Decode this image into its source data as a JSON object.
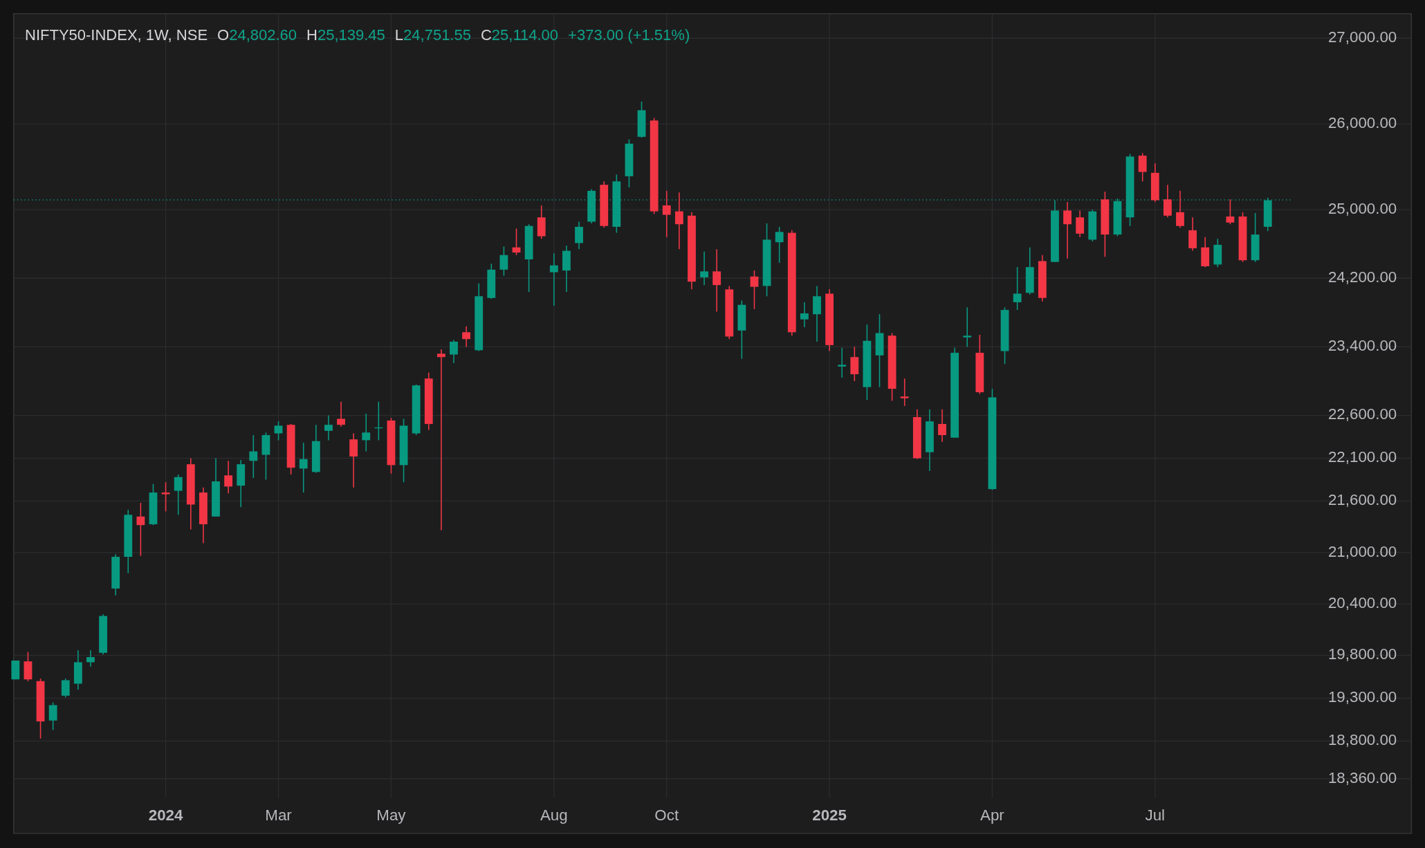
{
  "legend": {
    "symbol": "NIFTY50-INDEX, 1W, NSE",
    "values": [
      {
        "label": "O",
        "value": "24,802.60"
      },
      {
        "label": "H",
        "value": "25,139.45"
      },
      {
        "label": "L",
        "value": "24,751.55"
      },
      {
        "label": "C",
        "value": "25,114.00"
      }
    ],
    "change": "+373.00 (+1.51%)"
  },
  "chart": {
    "emphasized_labels": [
      true,
      false,
      false,
      false,
      false,
      true,
      false,
      false
    ],
    "chart_data": {
      "type": "candlestick",
      "ylim": [
        18137,
        27286
      ],
      "grid": true,
      "ref_lines": [
        {
          "axis": "y",
          "value": 25114,
          "color": "#089981"
        }
      ],
      "categories": [
        null,
        null,
        null,
        null,
        null,
        null,
        null,
        null,
        null,
        null,
        null,
        null,
        "2024",
        null,
        null,
        null,
        null,
        null,
        null,
        null,
        null,
        "Mar",
        null,
        null,
        null,
        null,
        null,
        null,
        null,
        null,
        "May",
        null,
        null,
        null,
        null,
        null,
        null,
        null,
        null,
        null,
        null,
        null,
        null,
        "Aug",
        null,
        null,
        null,
        null,
        null,
        null,
        null,
        null,
        "Oct",
        null,
        null,
        null,
        null,
        null,
        null,
        null,
        null,
        null,
        null,
        null,
        null,
        "2025",
        null,
        null,
        null,
        null,
        null,
        null,
        null,
        null,
        null,
        null,
        null,
        null,
        "Apr",
        null,
        null,
        null,
        null,
        null,
        null,
        null,
        null,
        null,
        null,
        null,
        null,
        "Jul",
        null,
        null,
        null,
        null,
        null,
        null,
        null,
        null,
        null
      ],
      "yticks": [
        {
          "value": 27000,
          "label": "27,000.00"
        },
        {
          "value": 26000,
          "label": "26,000.00"
        },
        {
          "value": 25000,
          "label": "25,000.00"
        },
        {
          "value": 24200,
          "label": "24,200.00"
        },
        {
          "value": 23400,
          "label": "23,400.00"
        },
        {
          "value": 22600,
          "label": "22,600.00"
        },
        {
          "value": 22100,
          "label": "22,100.00"
        },
        {
          "value": 21600,
          "label": "21,600.00"
        },
        {
          "value": 21000,
          "label": "21,000.00"
        },
        {
          "value": 20400,
          "label": "20,400.00"
        },
        {
          "value": 19800,
          "label": "19,800.00"
        },
        {
          "value": 19300,
          "label": "19,300.00"
        },
        {
          "value": 18800,
          "label": "18,800.00"
        },
        {
          "value": 18360,
          "label": "18,360.00"
        }
      ],
      "ohlc": [
        [
          19520,
          19740,
          19520,
          19740
        ],
        [
          19730,
          19840,
          19500,
          19520
        ],
        [
          19500,
          19530,
          18830,
          19030
        ],
        [
          19040,
          19250,
          18930,
          19220
        ],
        [
          19330,
          19530,
          19310,
          19510
        ],
        [
          19470,
          19860,
          19400,
          19720
        ],
        [
          19720,
          19860,
          19670,
          19780
        ],
        [
          19830,
          20280,
          19810,
          20260
        ],
        [
          20580,
          20980,
          20500,
          20950
        ],
        [
          20950,
          21500,
          20760,
          21440
        ],
        [
          21420,
          21580,
          20960,
          21320
        ],
        [
          21330,
          21800,
          21320,
          21700
        ],
        [
          21700,
          21820,
          21480,
          21680
        ],
        [
          21720,
          21910,
          21440,
          21880
        ],
        [
          22030,
          22100,
          21270,
          21560
        ],
        [
          21700,
          21760,
          21110,
          21330
        ],
        [
          21420,
          22100,
          21420,
          21830
        ],
        [
          21900,
          22070,
          21690,
          21770
        ],
        [
          21780,
          22080,
          21530,
          22030
        ],
        [
          22070,
          22370,
          21870,
          22180
        ],
        [
          22140,
          22400,
          21850,
          22370
        ],
        [
          22390,
          22530,
          22310,
          22480
        ],
        [
          22490,
          22500,
          21910,
          21990
        ],
        [
          21980,
          22280,
          21700,
          22090
        ],
        [
          21940,
          22490,
          21930,
          22300
        ],
        [
          22420,
          22600,
          22310,
          22490
        ],
        [
          22560,
          22760,
          22470,
          22490
        ],
        [
          22320,
          22390,
          21760,
          22120
        ],
        [
          22310,
          22620,
          22180,
          22400
        ],
        [
          22450,
          22760,
          22310,
          22460
        ],
        [
          22540,
          22570,
          21920,
          22020
        ],
        [
          22020,
          22560,
          21820,
          22480
        ],
        [
          22390,
          22960,
          22370,
          22950
        ],
        [
          23030,
          23100,
          22430,
          22500
        ],
        [
          23320,
          23370,
          21260,
          23280
        ],
        [
          23310,
          23480,
          23210,
          23460
        ],
        [
          23570,
          23640,
          23400,
          23490
        ],
        [
          23360,
          24140,
          23350,
          23990
        ],
        [
          23970,
          24370,
          23960,
          24300
        ],
        [
          24300,
          24570,
          24230,
          24470
        ],
        [
          24560,
          24780,
          24470,
          24500
        ],
        [
          24420,
          24830,
          24040,
          24810
        ],
        [
          24910,
          25050,
          24660,
          24690
        ],
        [
          24270,
          24490,
          23880,
          24350
        ],
        [
          24290,
          24580,
          24040,
          24520
        ],
        [
          24610,
          24860,
          24540,
          24800
        ],
        [
          24860,
          25240,
          24840,
          25220
        ],
        [
          25290,
          25330,
          24790,
          24810
        ],
        [
          24800,
          25410,
          24730,
          25330
        ],
        [
          25390,
          25820,
          25260,
          25770
        ],
        [
          25850,
          26260,
          25840,
          26160
        ],
        [
          26040,
          26070,
          24950,
          24980
        ],
        [
          25050,
          25220,
          24680,
          24940
        ],
        [
          24980,
          25200,
          24540,
          24830
        ],
        [
          24930,
          24970,
          24070,
          24160
        ],
        [
          24210,
          24510,
          24120,
          24280
        ],
        [
          24280,
          24540,
          23810,
          24120
        ],
        [
          24070,
          24110,
          23490,
          23520
        ],
        [
          23590,
          23940,
          23260,
          23890
        ],
        [
          24220,
          24290,
          23840,
          24100
        ],
        [
          24110,
          24840,
          23990,
          24650
        ],
        [
          24620,
          24800,
          24380,
          24740
        ],
        [
          24730,
          24760,
          23530,
          23570
        ],
        [
          23720,
          23920,
          23630,
          23790
        ],
        [
          23780,
          24110,
          23460,
          23990
        ],
        [
          24020,
          24070,
          23350,
          23420
        ],
        [
          23170,
          23390,
          23040,
          23190
        ],
        [
          23280,
          23400,
          23000,
          23080
        ],
        [
          22930,
          23660,
          22780,
          23470
        ],
        [
          23300,
          23780,
          22930,
          23560
        ],
        [
          23530,
          23560,
          22770,
          22910
        ],
        [
          22820,
          23030,
          22710,
          22800
        ],
        [
          22580,
          22670,
          22090,
          22100
        ],
        [
          22170,
          22670,
          21950,
          22530
        ],
        [
          22500,
          22670,
          22290,
          22370
        ],
        [
          22340,
          23390,
          22340,
          23330
        ],
        [
          23510,
          23860,
          23400,
          23530
        ],
        [
          23330,
          23540,
          22850,
          22870
        ],
        [
          21740,
          22910,
          21730,
          22810
        ],
        [
          23350,
          23860,
          23200,
          23830
        ],
        [
          23920,
          24330,
          23830,
          24020
        ],
        [
          24030,
          24560,
          24010,
          24330
        ],
        [
          24400,
          24470,
          23930,
          23970
        ],
        [
          24390,
          25110,
          24390,
          24990
        ],
        [
          24990,
          25090,
          24430,
          24830
        ],
        [
          24910,
          24990,
          24680,
          24720
        ],
        [
          24650,
          25000,
          24630,
          24980
        ],
        [
          25120,
          25210,
          24450,
          24710
        ],
        [
          24710,
          25130,
          24690,
          25100
        ],
        [
          24910,
          25650,
          24810,
          25620
        ],
        [
          25630,
          25660,
          25330,
          25440
        ],
        [
          25430,
          25540,
          25090,
          25110
        ],
        [
          25120,
          25290,
          24910,
          24930
        ],
        [
          24970,
          25220,
          24790,
          24810
        ],
        [
          24760,
          24910,
          24520,
          24550
        ],
        [
          24560,
          24680,
          24330,
          24340
        ],
        [
          24360,
          24660,
          24330,
          24590
        ],
        [
          24920,
          25120,
          24830,
          24850
        ],
        [
          24920,
          24970,
          24390,
          24410
        ],
        [
          24410,
          24960,
          24390,
          24710
        ],
        [
          24800,
          25140,
          24750,
          25110
        ]
      ]
    }
  }
}
